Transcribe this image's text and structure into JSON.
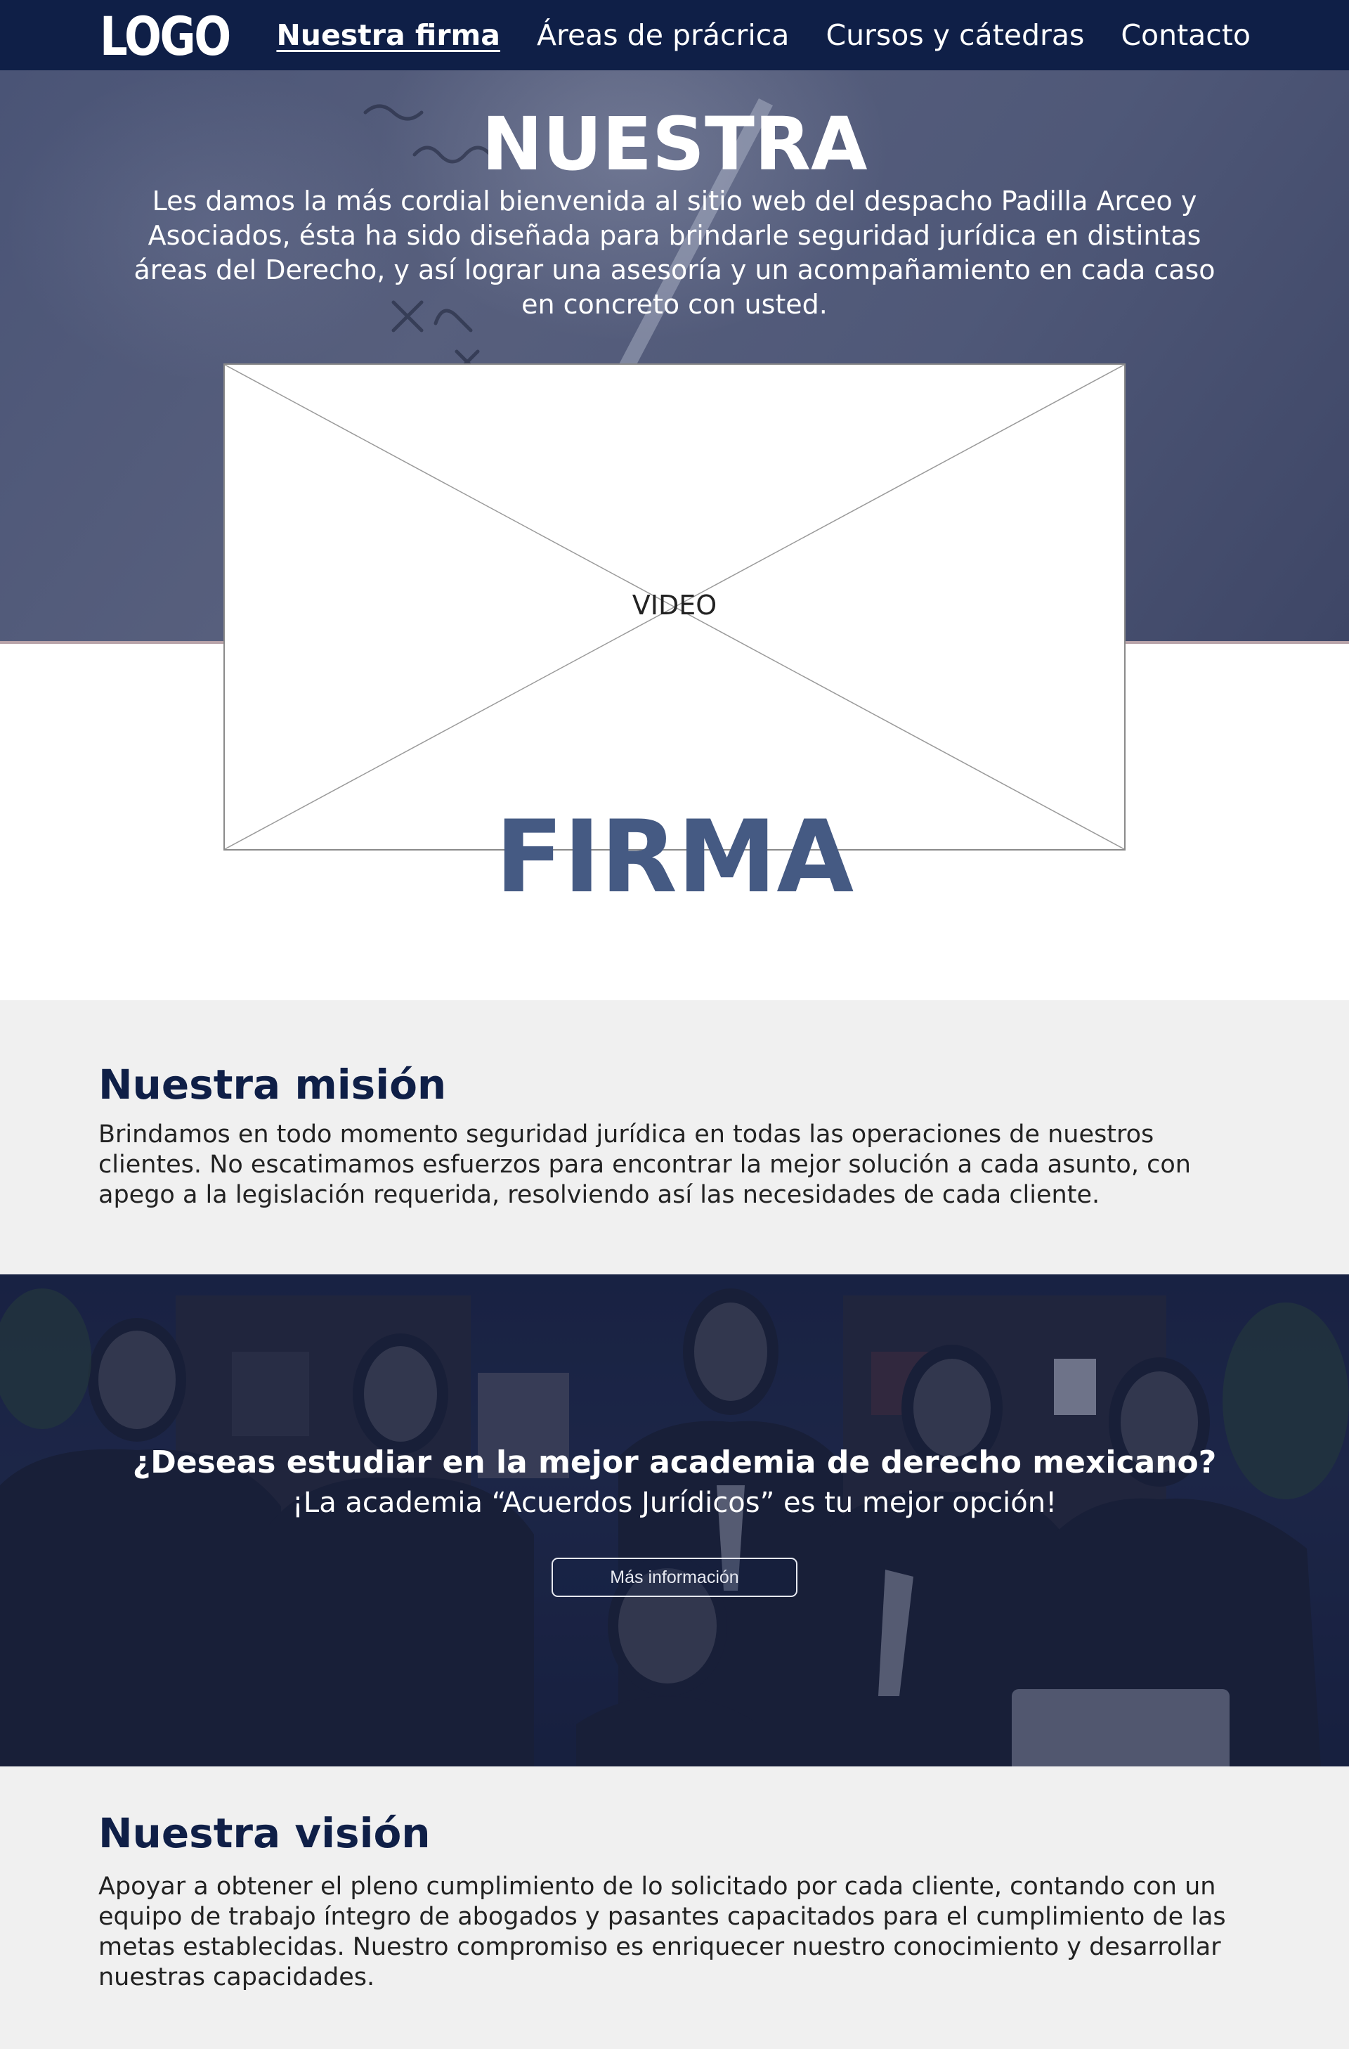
{
  "nav": {
    "logo": "LOGO",
    "links": [
      {
        "label": "Nuestra firma",
        "active": true
      },
      {
        "label": "Áreas de prácrica",
        "active": false
      },
      {
        "label": "Cursos y cátedras",
        "active": false
      },
      {
        "label": "Contacto",
        "active": false
      }
    ]
  },
  "hero": {
    "title": "NUESTRA",
    "intro": "Les damos la más cordial bienvenida al sitio web del despacho Padilla Arceo y Asociados, ésta ha sido diseñada para brindarle seguridad jurídica en distintas áreas del Derecho, y así lograr una asesoría y un acompañamiento en cada caso en concreto con usted.",
    "video_label": "VIDEO",
    "title_part2": "FIRMA"
  },
  "mission": {
    "heading": "Nuestra misión",
    "text": "Brindamos en todo momento seguridad jurídica en todas las operaciones de nuestros clientes. No escatimamos esfuerzos para encontrar la mejor solución a cada asunto, con apego a la legislación requerida, resolviendo así las necesidades de cada cliente."
  },
  "academy": {
    "question": "¿Deseas estudiar en la mejor academia de derecho mexicano?",
    "subtitle": "¡La academia “Acuerdos Jurídicos” es tu mejor opción!",
    "button_label": "Más información"
  },
  "vision": {
    "heading": "Nuestra visión",
    "text": "Apoyar a obtener el pleno cumplimiento de lo solicitado por cada cliente, contando con un equipo de trabajo íntegro de abogados y pasantes capacitados para el cumplimiento de las metas establecidas. Nuestro compromiso es enriquecer nuestro conocimiento y desarrollar nuestras capacidades."
  },
  "colors": {
    "navy": "#0f1f47",
    "firma_blue": "#455a83",
    "section_bg": "#f0f0f0",
    "hero_overlay": "#4f5878"
  }
}
